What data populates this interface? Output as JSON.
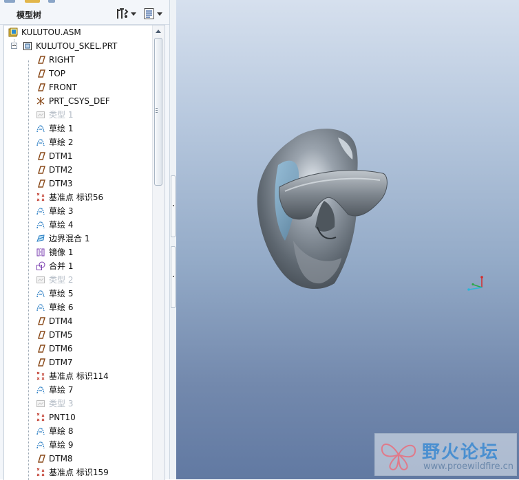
{
  "panel": {
    "title": "模型树",
    "tools": [
      "settings-icon",
      "show-icon"
    ]
  },
  "tree": {
    "root": {
      "label": "KULUTOU.ASM",
      "icon": "assembly-icon"
    },
    "part": {
      "label": "KULUTOU_SKEL.PRT",
      "icon": "part-icon"
    },
    "items": [
      {
        "label": "RIGHT",
        "icon": "datum-plane-icon",
        "dim": false
      },
      {
        "label": "TOP",
        "icon": "datum-plane-icon",
        "dim": false
      },
      {
        "label": "FRONT",
        "icon": "datum-plane-icon",
        "dim": false
      },
      {
        "label": "PRT_CSYS_DEF",
        "icon": "csys-icon",
        "dim": false
      },
      {
        "label": "类型 1",
        "icon": "type-feature-icon",
        "dim": true
      },
      {
        "label": "草绘 1",
        "icon": "sketch-icon",
        "dim": false
      },
      {
        "label": "草绘 2",
        "icon": "sketch-icon",
        "dim": false
      },
      {
        "label": "DTM1",
        "icon": "datum-plane-icon",
        "dim": false
      },
      {
        "label": "DTM2",
        "icon": "datum-plane-icon",
        "dim": false
      },
      {
        "label": "DTM3",
        "icon": "datum-plane-icon",
        "dim": false
      },
      {
        "label": "基准点 标识56",
        "icon": "datum-point-icon",
        "dim": false
      },
      {
        "label": "草绘 3",
        "icon": "sketch-icon",
        "dim": false
      },
      {
        "label": "草绘 4",
        "icon": "sketch-icon",
        "dim": false
      },
      {
        "label": "边界混合 1",
        "icon": "boundary-blend-icon",
        "dim": false
      },
      {
        "label": "镜像 1",
        "icon": "mirror-icon",
        "dim": false
      },
      {
        "label": "合并 1",
        "icon": "merge-icon",
        "dim": false
      },
      {
        "label": "类型 2",
        "icon": "type-feature-icon",
        "dim": true
      },
      {
        "label": "草绘 5",
        "icon": "sketch-icon",
        "dim": false
      },
      {
        "label": "草绘 6",
        "icon": "sketch-icon",
        "dim": false
      },
      {
        "label": "DTM4",
        "icon": "datum-plane-icon",
        "dim": false
      },
      {
        "label": "DTM5",
        "icon": "datum-plane-icon",
        "dim": false
      },
      {
        "label": "DTM6",
        "icon": "datum-plane-icon",
        "dim": false
      },
      {
        "label": "DTM7",
        "icon": "datum-plane-icon",
        "dim": false
      },
      {
        "label": "基准点 标识114",
        "icon": "datum-point-icon",
        "dim": false
      },
      {
        "label": "草绘 7",
        "icon": "sketch-icon",
        "dim": false
      },
      {
        "label": "类型 3",
        "icon": "type-feature-icon",
        "dim": true
      },
      {
        "label": "PNT10",
        "icon": "datum-point-icon",
        "dim": false
      },
      {
        "label": "草绘 8",
        "icon": "sketch-icon",
        "dim": false
      },
      {
        "label": "草绘 9",
        "icon": "sketch-icon",
        "dim": false
      },
      {
        "label": "DTM8",
        "icon": "datum-plane-icon",
        "dim": false
      },
      {
        "label": "基准点 标识159",
        "icon": "datum-point-icon",
        "dim": false
      }
    ]
  },
  "watermark": {
    "name_cn": "野火论坛",
    "url": "www.proewildfire.cn"
  },
  "colors": {
    "datum_plane": "#8a4a1a",
    "sketch": "#2d7fc4",
    "datum_point": "#c0392b",
    "merge": "#7b3fb0",
    "viewport_top": "#d6e0ee",
    "viewport_bottom": "#6179a2"
  }
}
